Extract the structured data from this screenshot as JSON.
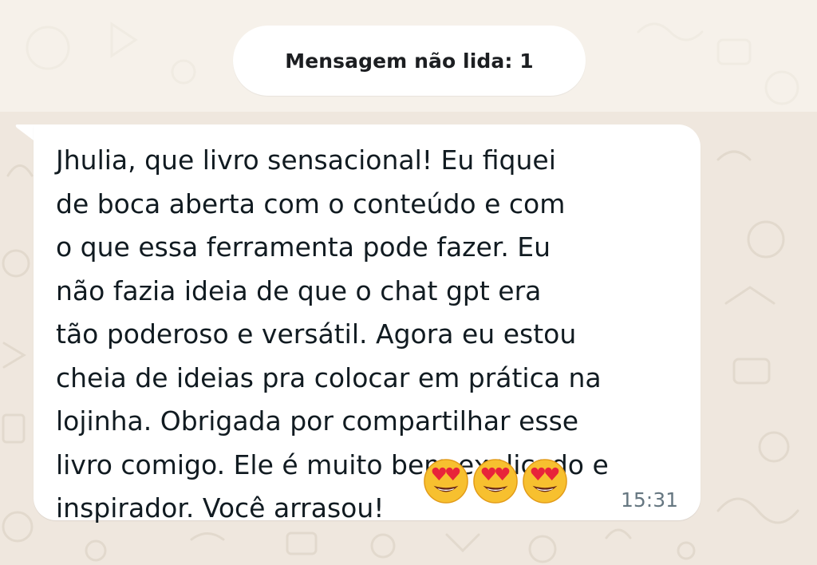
{
  "chat": {
    "unread_banner": "Mensagem não lida: 1",
    "message": {
      "text_lines": [
        "Jhulia, que livro sensacional! Eu fiquei",
        "de boca aberta com o conteúdo e com",
        "o que essa ferramenta pode fazer. Eu",
        "não fazia ideia de que o  chat gpt era",
        "tão poderoso e versátil. Agora eu estou",
        "cheia de ideias pra colocar em prática na",
        "lojinha. Obrigada por compartilhar esse",
        "livro comigo. Ele é muito bem explicado e",
        "inspirador. Você arrasou!"
      ],
      "emojis": [
        "smiling-face-with-heart-eyes-icon",
        "smiling-face-with-heart-eyes-icon",
        "smiling-face-with-heart-eyes-icon"
      ],
      "time": "15:31"
    }
  },
  "colors": {
    "wallpaper": "#efe7de",
    "bubble": "#ffffff",
    "text": "#111b21",
    "timestamp": "#667781"
  }
}
